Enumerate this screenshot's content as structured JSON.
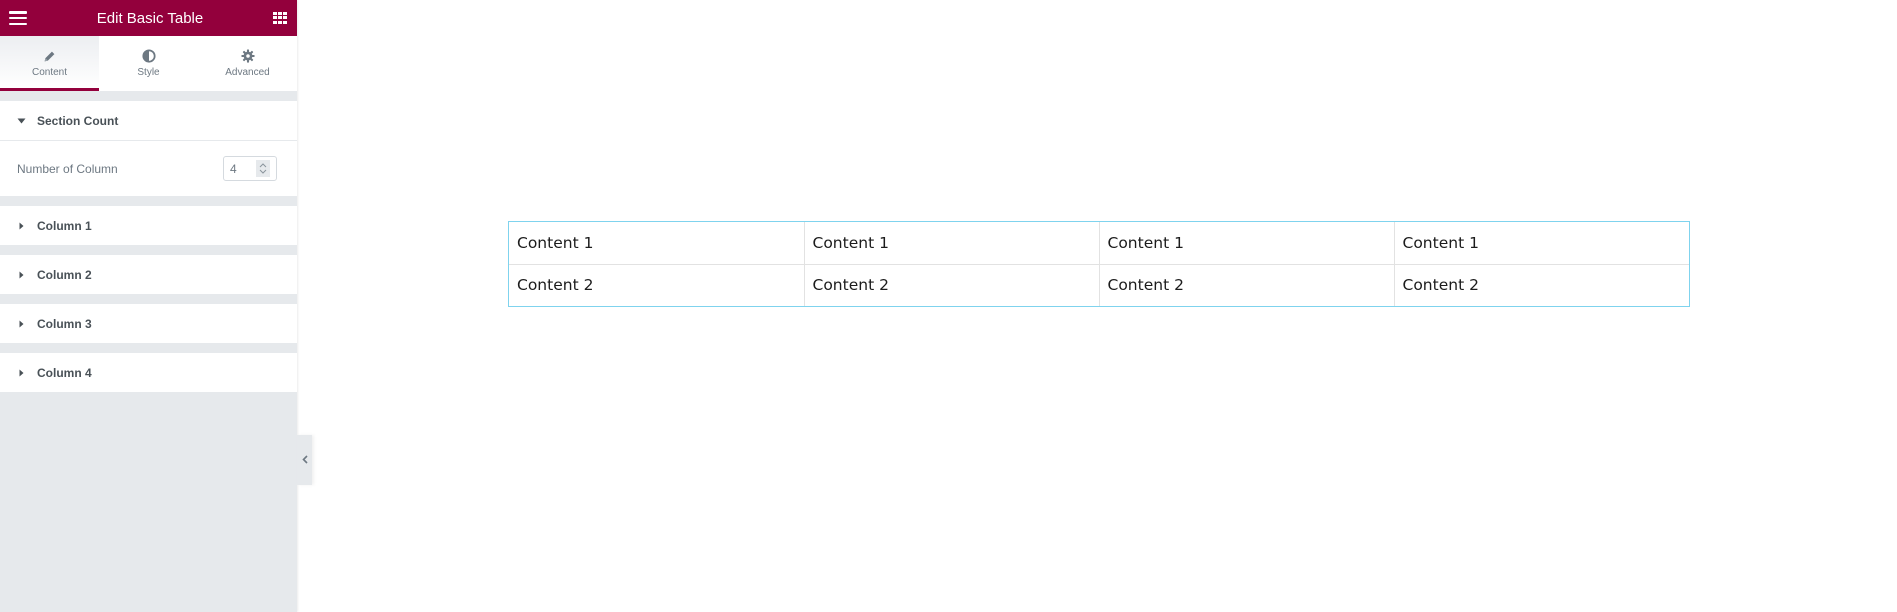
{
  "panel": {
    "title": "Edit Basic Table",
    "header_left_icon": "hamburger-menu-icon",
    "header_right_icon": "apps-grid-icon",
    "accent_color": "#93003c",
    "tabs": [
      {
        "label": "Content",
        "icon": "pencil-icon",
        "active": true
      },
      {
        "label": "Style",
        "icon": "half-circle-icon",
        "active": false
      },
      {
        "label": "Advanced",
        "icon": "gear-icon",
        "active": false
      }
    ],
    "sections": [
      {
        "title": "Section Count",
        "expanded": true,
        "control": {
          "label": "Number of Column",
          "value": "4"
        }
      },
      {
        "title": "Column 1",
        "expanded": false
      },
      {
        "title": "Column 2",
        "expanded": false
      },
      {
        "title": "Column 3",
        "expanded": false
      },
      {
        "title": "Column 4",
        "expanded": false
      }
    ],
    "collapse_icon": "chevron-left-icon"
  },
  "table": {
    "rows": [
      [
        "Content 1",
        "Content 1",
        "Content 1",
        "Content 1"
      ],
      [
        "Content 2",
        "Content 2",
        "Content 2",
        "Content 2"
      ]
    ],
    "border_color": "#7fd3ee"
  }
}
